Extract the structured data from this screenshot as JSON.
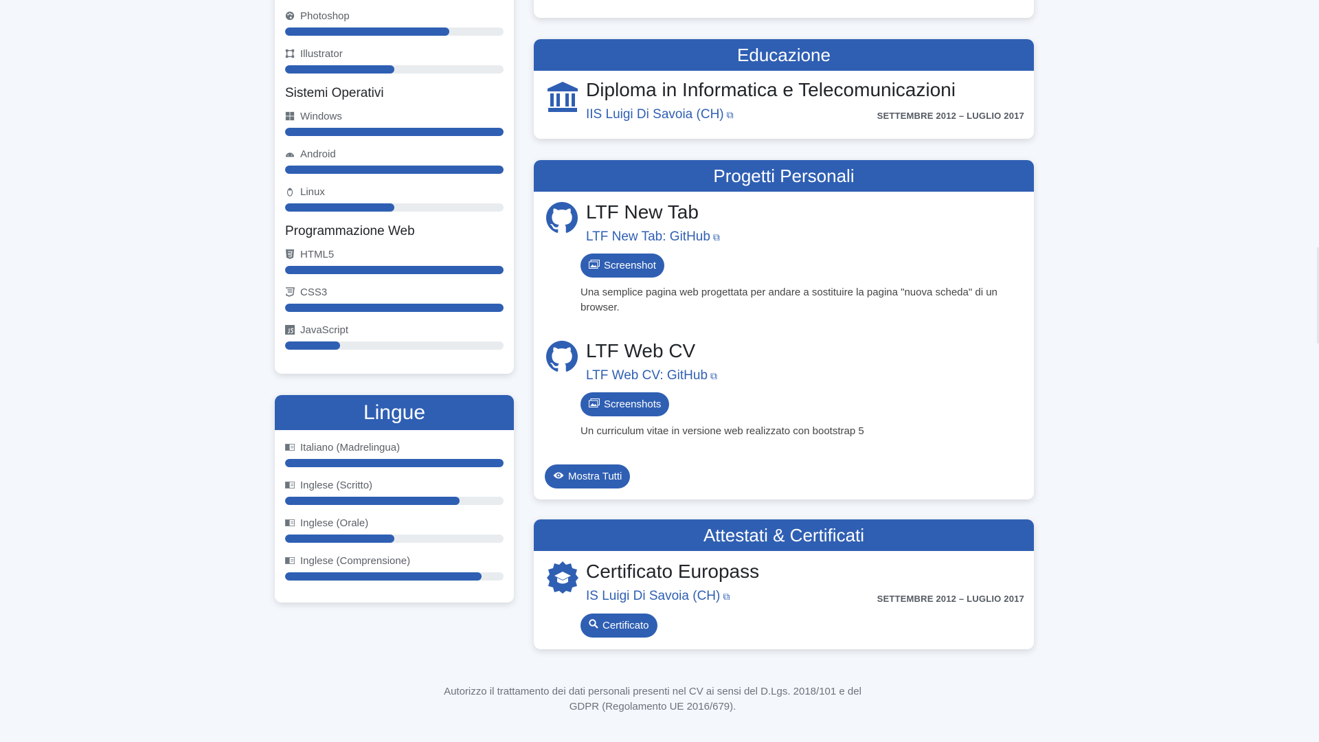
{
  "skills": {
    "top_items": [
      {
        "label": "Photoshop",
        "icon": "palette-icon",
        "level": 0.75
      },
      {
        "label": "Illustrator",
        "icon": "vector-square-icon",
        "level": 0.5
      }
    ],
    "groups": [
      {
        "title": "Sistemi Operativi",
        "items": [
          {
            "label": "Windows",
            "icon": "windows-icon",
            "level": 1.0
          },
          {
            "label": "Android",
            "icon": "android-icon",
            "level": 1.0
          },
          {
            "label": "Linux",
            "icon": "linux-icon",
            "level": 0.5
          }
        ]
      },
      {
        "title": "Programmazione Web",
        "items": [
          {
            "label": "HTML5",
            "icon": "html5-icon",
            "level": 1.0
          },
          {
            "label": "CSS3",
            "icon": "css3-icon",
            "level": 1.0
          },
          {
            "label": "JavaScript",
            "icon": "javascript-icon",
            "level": 0.25
          }
        ]
      }
    ]
  },
  "lingue": {
    "title": "Lingue",
    "items": [
      {
        "label": "Italiano (Madrelingua)",
        "icon": "language-icon",
        "level": 1.0
      },
      {
        "label": "Inglese (Scritto)",
        "icon": "language-icon",
        "level": 0.8
      },
      {
        "label": "Inglese (Orale)",
        "icon": "language-icon",
        "level": 0.5
      },
      {
        "label": "Inglese (Comprensione)",
        "icon": "language-icon",
        "level": 0.9
      }
    ]
  },
  "educazione": {
    "title": "Educazione",
    "degree": "Diploma in Informatica e Telecomunicazioni",
    "school": "IIS Luigi Di Savoia (CH)",
    "dates": "SETTEMBRE 2012 – LUGLIO 2017"
  },
  "progetti": {
    "title": "Progetti Personali",
    "items": [
      {
        "name": "LTF New Tab",
        "link": "LTF New Tab: GitHub",
        "button": "Screenshot",
        "description": "Una semplice pagina web progettata per andare a sostituire la pagina \"nuova scheda\" di un browser."
      },
      {
        "name": "LTF Web CV",
        "link": "LTF Web CV: GitHub",
        "button": "Screenshots",
        "description": "Un curriculum vitae in versione web realizzato con bootstrap 5"
      }
    ],
    "show_all": "Mostra Tutti"
  },
  "attestati": {
    "title": "Attestati & Certificati",
    "name": "Certificato Europass",
    "school": "IS Luigi Di Savoia (CH)",
    "dates": "SETTEMBRE 2012 – LUGLIO 2017",
    "button": "Certificato"
  },
  "footer": {
    "line1": "Autorizzo il trattamento dei dati personali presenti nel CV ai sensi del D.Lgs. 2018/101 e del",
    "line2": "GDPR (Regolamento UE 2016/679)."
  },
  "colors": {
    "primary": "#2f5fb3",
    "background": "#f4f7fc",
    "bar_track": "#e9ecef"
  }
}
